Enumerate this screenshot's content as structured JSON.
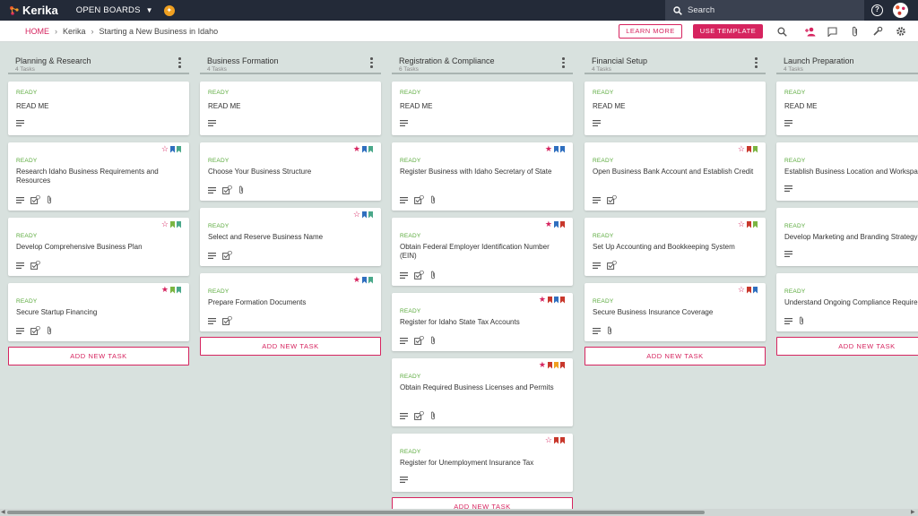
{
  "app": {
    "brand": "Kerika",
    "open_boards": "OPEN BOARDS",
    "search_placeholder": "Search"
  },
  "breadcrumb": {
    "home": "HOME",
    "account": "Kerika",
    "board": "Starting a New Business in Idaho"
  },
  "toolbar": {
    "learn_more": "LEARN MORE",
    "use_template": "USE TEMPLATE",
    "icons": [
      "search-icon",
      "add-person-icon",
      "chat-icon",
      "attachment-icon",
      "tools-icon",
      "gear-icon"
    ]
  },
  "colors": {
    "accent": "#d6245f",
    "ready": "#58a93a",
    "topbar": "#232a38",
    "background": "#d8e1de"
  },
  "columns": [
    {
      "title": "Planning & Research",
      "count": "4 Tasks",
      "add_label": "ADD NEW TASK",
      "cards": [
        {
          "status": "READY",
          "title": "READ ME",
          "icons": [
            "desc"
          ],
          "star": "",
          "flags": []
        },
        {
          "status": "READY",
          "title": "Research Idaho Business Requirements and Resources",
          "icons": [
            "desc",
            "check",
            "clip"
          ],
          "star": "outline",
          "flags": [
            "#2f6fbf",
            "#4aa88a"
          ]
        },
        {
          "status": "READY",
          "title": "Develop Comprehensive Business Plan",
          "icons": [
            "desc",
            "check"
          ],
          "star": "outline",
          "flags": [
            "#7bb542",
            "#4aa88a"
          ]
        },
        {
          "status": "READY",
          "title": "Secure Startup Financing",
          "icons": [
            "desc",
            "check",
            "clip"
          ],
          "star": "filled",
          "flags": [
            "#7bb542",
            "#4aa88a"
          ]
        }
      ]
    },
    {
      "title": "Business Formation",
      "count": "4 Tasks",
      "add_label": "ADD NEW TASK",
      "cards": [
        {
          "status": "READY",
          "title": "READ ME",
          "icons": [
            "desc"
          ],
          "star": "",
          "flags": []
        },
        {
          "status": "READY",
          "title": "Choose Your Business Structure",
          "icons": [
            "desc",
            "check",
            "clip"
          ],
          "star": "filled",
          "flags": [
            "#2f6fbf",
            "#4aa88a"
          ]
        },
        {
          "status": "READY",
          "title": "Select and Reserve Business Name",
          "icons": [
            "desc",
            "check"
          ],
          "star": "outline",
          "flags": [
            "#2f6fbf",
            "#4aa88a"
          ]
        },
        {
          "status": "READY",
          "title": "Prepare Formation Documents",
          "icons": [
            "desc",
            "check"
          ],
          "star": "filled",
          "flags": [
            "#2f6fbf",
            "#4aa88a"
          ]
        }
      ]
    },
    {
      "title": "Registration & Compliance",
      "count": "6 Tasks",
      "add_label": "ADD NEW TASK",
      "cards": [
        {
          "status": "READY",
          "title": "READ ME",
          "icons": [
            "desc"
          ],
          "star": "",
          "flags": []
        },
        {
          "status": "READY",
          "title": "Register Business with Idaho Secretary of State",
          "icons": [
            "desc",
            "check",
            "clip"
          ],
          "star": "filled",
          "flags": [
            "#2f6fbf",
            "#2f6fbf"
          ]
        },
        {
          "status": "READY",
          "title": "Obtain Federal Employer Identification Number (EIN)",
          "icons": [
            "desc",
            "check",
            "clip"
          ],
          "star": "filled",
          "flags": [
            "#2f6fbf",
            "#c8382c"
          ]
        },
        {
          "status": "READY",
          "title": "Register for Idaho State Tax Accounts",
          "icons": [
            "desc",
            "check",
            "clip"
          ],
          "star": "filled",
          "flags": [
            "#c8382c",
            "#2f6fbf",
            "#c8382c"
          ]
        },
        {
          "status": "READY",
          "title": "Obtain Required Business Licenses and Permits",
          "icons": [
            "desc",
            "check",
            "clip"
          ],
          "star": "filled",
          "flags": [
            "#c8382c",
            "#f0a020",
            "#c8382c"
          ]
        },
        {
          "status": "READY",
          "title": "Register for Unemployment Insurance Tax",
          "icons": [
            "desc"
          ],
          "star": "outline",
          "flags": [
            "#c8382c",
            "#c8382c"
          ]
        }
      ]
    },
    {
      "title": "Financial Setup",
      "count": "4 Tasks",
      "add_label": "ADD NEW TASK",
      "cards": [
        {
          "status": "READY",
          "title": "READ ME",
          "icons": [
            "desc"
          ],
          "star": "",
          "flags": []
        },
        {
          "status": "READY",
          "title": "Open Business Bank Account and Establish Credit",
          "icons": [
            "desc",
            "check"
          ],
          "star": "outline",
          "flags": [
            "#c8382c",
            "#7bb542"
          ]
        },
        {
          "status": "READY",
          "title": "Set Up Accounting and Bookkeeping System",
          "icons": [
            "desc",
            "check"
          ],
          "star": "outline",
          "flags": [
            "#c8382c",
            "#7bb542"
          ]
        },
        {
          "status": "READY",
          "title": "Secure Business Insurance Coverage",
          "icons": [
            "desc",
            "clip"
          ],
          "star": "outline",
          "flags": [
            "#c8382c",
            "#2f6fbf"
          ]
        }
      ]
    },
    {
      "title": "Launch Preparation",
      "count": "4 Tasks",
      "add_label": "ADD NEW TASK",
      "cards": [
        {
          "status": "READY",
          "title": "READ ME",
          "icons": [
            "desc"
          ],
          "star": "",
          "flags": []
        },
        {
          "status": "READY",
          "title": "Establish Business Location and Workspace",
          "icons": [
            "desc"
          ],
          "star": "",
          "flags": []
        },
        {
          "status": "READY",
          "title": "Develop Marketing and Branding Strategy",
          "icons": [
            "desc"
          ],
          "star": "",
          "flags": []
        },
        {
          "status": "READY",
          "title": "Understand Ongoing Compliance Requirements",
          "icons": [
            "desc",
            "clip"
          ],
          "star": "",
          "flags": []
        }
      ]
    }
  ]
}
